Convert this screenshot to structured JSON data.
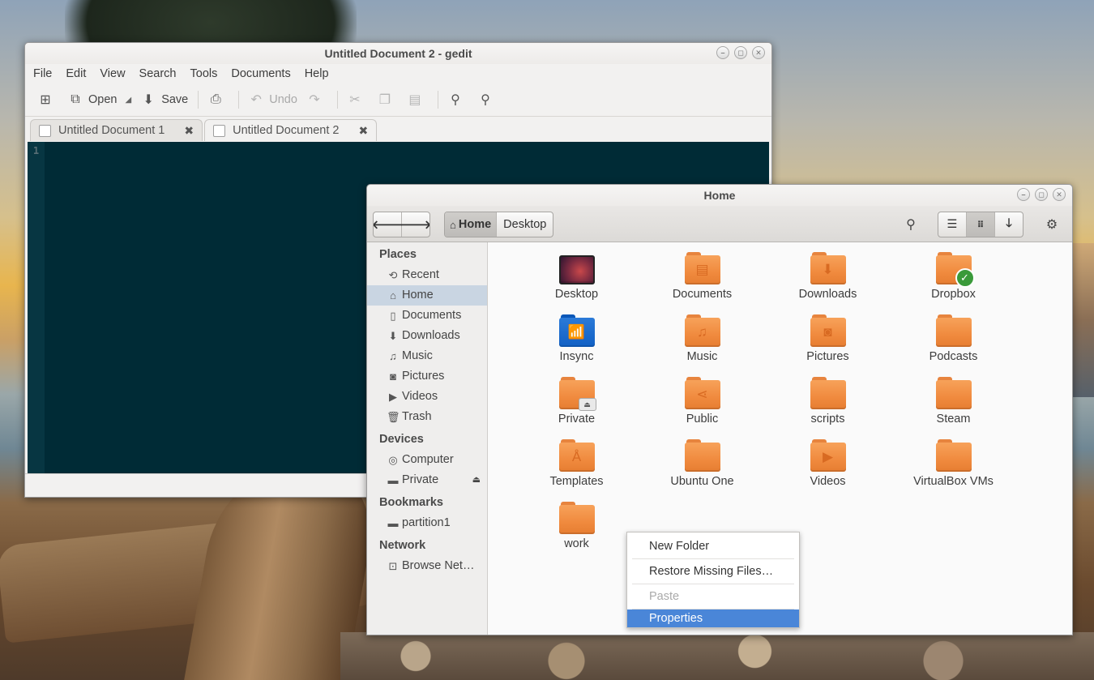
{
  "gedit": {
    "title": "Untitled Document 2 - gedit",
    "menu": [
      "File",
      "Edit",
      "View",
      "Search",
      "Tools",
      "Documents",
      "Help"
    ],
    "toolbar": {
      "open_label": "Open",
      "save_label": "Save",
      "undo_label": "Undo"
    },
    "tabs": [
      {
        "label": "Untitled Document 1"
      },
      {
        "label": "Untitled Document 2"
      }
    ],
    "line_number": "1",
    "colors": {
      "editor_bg": "#002b36",
      "gutter_bg": "#073642"
    }
  },
  "nautilus": {
    "title": "Home",
    "path": {
      "home_label": "Home",
      "desktop_label": "Desktop"
    },
    "sidebar": {
      "places_header": "Places",
      "places": [
        {
          "label": "Recent",
          "icon": "clock-icon"
        },
        {
          "label": "Home",
          "icon": "home-icon"
        },
        {
          "label": "Documents",
          "icon": "document-icon"
        },
        {
          "label": "Downloads",
          "icon": "download-icon"
        },
        {
          "label": "Music",
          "icon": "music-icon"
        },
        {
          "label": "Pictures",
          "icon": "camera-icon"
        },
        {
          "label": "Videos",
          "icon": "video-icon"
        },
        {
          "label": "Trash",
          "icon": "trash-icon"
        }
      ],
      "devices_header": "Devices",
      "devices": [
        {
          "label": "Computer",
          "icon": "disk-icon"
        },
        {
          "label": "Private",
          "icon": "folder-icon"
        }
      ],
      "bookmarks_header": "Bookmarks",
      "bookmarks": [
        {
          "label": "partition1",
          "icon": "folder-icon"
        }
      ],
      "network_header": "Network",
      "network": [
        {
          "label": "Browse Net…",
          "icon": "network-icon"
        }
      ]
    },
    "files": [
      {
        "label": "Desktop"
      },
      {
        "label": "Documents"
      },
      {
        "label": "Downloads"
      },
      {
        "label": "Dropbox"
      },
      {
        "label": "Insync"
      },
      {
        "label": "Music"
      },
      {
        "label": "Pictures"
      },
      {
        "label": "Podcasts"
      },
      {
        "label": "Private"
      },
      {
        "label": "Public"
      },
      {
        "label": "scripts"
      },
      {
        "label": "Steam"
      },
      {
        "label": "Templates"
      },
      {
        "label": "Ubuntu One"
      },
      {
        "label": "Videos"
      },
      {
        "label": "VirtualBox VMs"
      },
      {
        "label": "work"
      }
    ],
    "colors": {
      "folder": "#f08a3e",
      "selection": "#c9d5e2"
    }
  },
  "context_menu": {
    "items": [
      {
        "label": "New Folder"
      },
      {
        "label": "Restore Missing Files…"
      },
      {
        "label": "Paste"
      },
      {
        "label": "Properties"
      }
    ],
    "highlight_color": "#4a86d8"
  }
}
